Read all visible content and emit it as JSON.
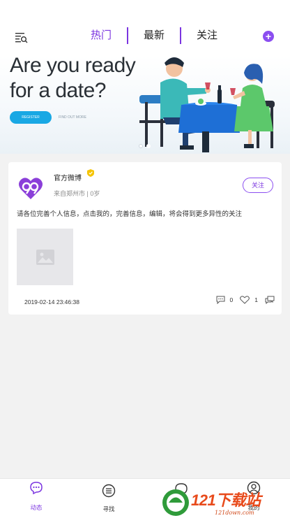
{
  "top_nav": {
    "tabs": [
      {
        "label": "热门",
        "active": true
      },
      {
        "label": "最新",
        "active": false
      },
      {
        "label": "关注",
        "active": false
      }
    ],
    "plus_symbol": "+",
    "accent_color": "#7b35e0"
  },
  "banner": {
    "headline_line1": "Are you ready",
    "headline_line2": "for a date?",
    "register_label": "REGISTER",
    "find_out_label": "FIND OUT MORE",
    "slide_count": 2,
    "active_slide": 2
  },
  "post": {
    "author": "官方微博",
    "meta": "来自郑州市 | 0岁",
    "follow_label": "关注",
    "text": "请各位完善个人信息，点击我的，完善信息，编辑，将会得到更多异性的关注",
    "time": "2019-02-14 23:46:38",
    "comment_count": "0",
    "like_count": "1"
  },
  "bottom_nav": {
    "items": [
      {
        "label": "动态",
        "icon": "chat-bubble-icon",
        "active": true
      },
      {
        "label": "寻找",
        "icon": "list-circle-icon",
        "active": false
      },
      {
        "label": "",
        "icon": "message-icon",
        "active": false
      },
      {
        "label": "我的",
        "icon": "user-icon",
        "active": false
      }
    ]
  },
  "watermark": {
    "brand": "121下载站",
    "url": "121down.com"
  }
}
